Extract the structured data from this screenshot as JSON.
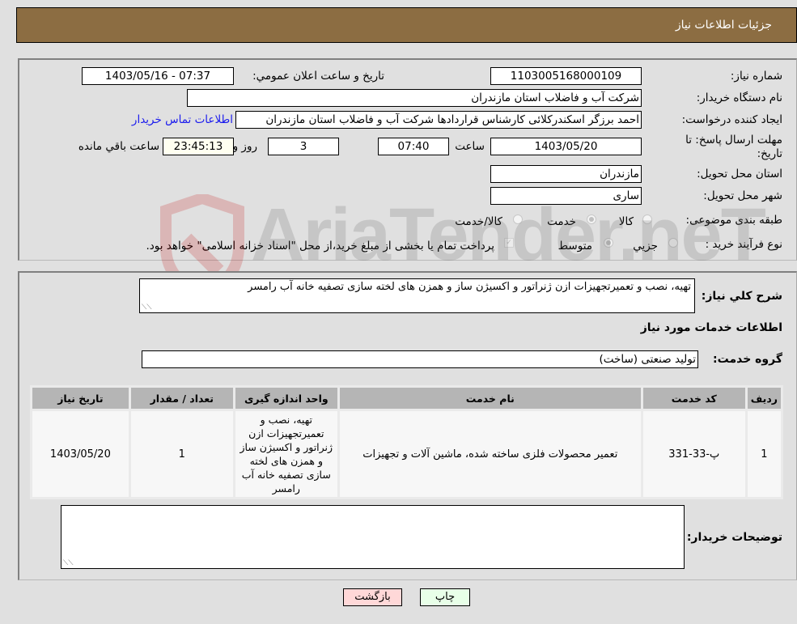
{
  "header": {
    "title": "جزئیات اطلاعات نیاز"
  },
  "form": {
    "need_number": {
      "label": "شماره نیاز:",
      "value": "1103005168000109"
    },
    "announce_datetime": {
      "label": "تاریخ و ساعت اعلان عمومي:",
      "value": "1403/05/16 - 07:37"
    },
    "buyer_org": {
      "label": "نام دستگاه خریدار:",
      "value": "شرکت آب و فاضلاب استان مازندران"
    },
    "requester": {
      "label": "ایجاد کننده درخواست:",
      "value": "احمد برزگر اسکندرکلائی کارشناس قراردادها شرکت آب و فاضلاب استان مازندران",
      "contact_link": "اطلاعات تماس خریدار"
    },
    "deadline": {
      "label": "مهلت ارسال پاسخ: تا تاریخ:",
      "date": "1403/05/20",
      "time_label": "ساعت",
      "time": "07:40",
      "days": "3",
      "days_label": "روز و",
      "remaining": "23:45:13",
      "remaining_label": "ساعت باقي مانده"
    },
    "province": {
      "label": "استان محل تحویل:",
      "value": "مازندران"
    },
    "city": {
      "label": "شهر محل تحویل:",
      "value": "ساری"
    },
    "category": {
      "label": "طبقه بندی موضوعی:",
      "options": [
        "کالا",
        "خدمت",
        "کالا/خدمت"
      ],
      "selected": "خدمت"
    },
    "purchase_type": {
      "label": "نوع فرآیند خرید :",
      "options": [
        "جزيي",
        "متوسط"
      ],
      "selected": "متوسط",
      "treasury_note": "پرداخت تمام یا بخشی از مبلغ خرید،از محل \"اسناد خزانه اسلامی\" خواهد بود."
    }
  },
  "details": {
    "description_label": "شرح کلي نياز:",
    "description": "تهیه، نصب و تعمیرتجهیزات ازن ژنراتور و اکسیژن ساز و همزن های لخته سازی تصفیه خانه آب رامسر",
    "services_title": "اطلاعات خدمات مورد نياز",
    "service_group_label": "گروه خدمت:",
    "service_group": "تولید صنعتی (ساخت)",
    "table": {
      "headers": [
        "ردیف",
        "کد خدمت",
        "نام خدمت",
        "واحد اندازه گیری",
        "تعداد / مقدار",
        "تاریخ نیاز"
      ],
      "rows": [
        [
          "1",
          "پ-33-331",
          "تعمیر محصولات فلزی ساخته شده، ماشین آلات و تجهیزات",
          "تهیه، نصب و تعمیرتجهیزات ازن ژنراتور و اکسیژن ساز و همزن های لخته سازی تصفیه خانه آب رامسر",
          "1",
          "1403/05/20"
        ]
      ]
    },
    "buyer_notes_label": "توضیحات خریدار:",
    "buyer_notes": ""
  },
  "buttons": {
    "print": "چاپ",
    "back": "بازگشت"
  },
  "colors": {
    "header_bg": "#8c6d42",
    "print_bg": "#e8ffe8",
    "back_bg": "#ffd8d8",
    "link": "#1a1aee"
  },
  "watermark": {
    "text": "AriaTender.neT"
  }
}
